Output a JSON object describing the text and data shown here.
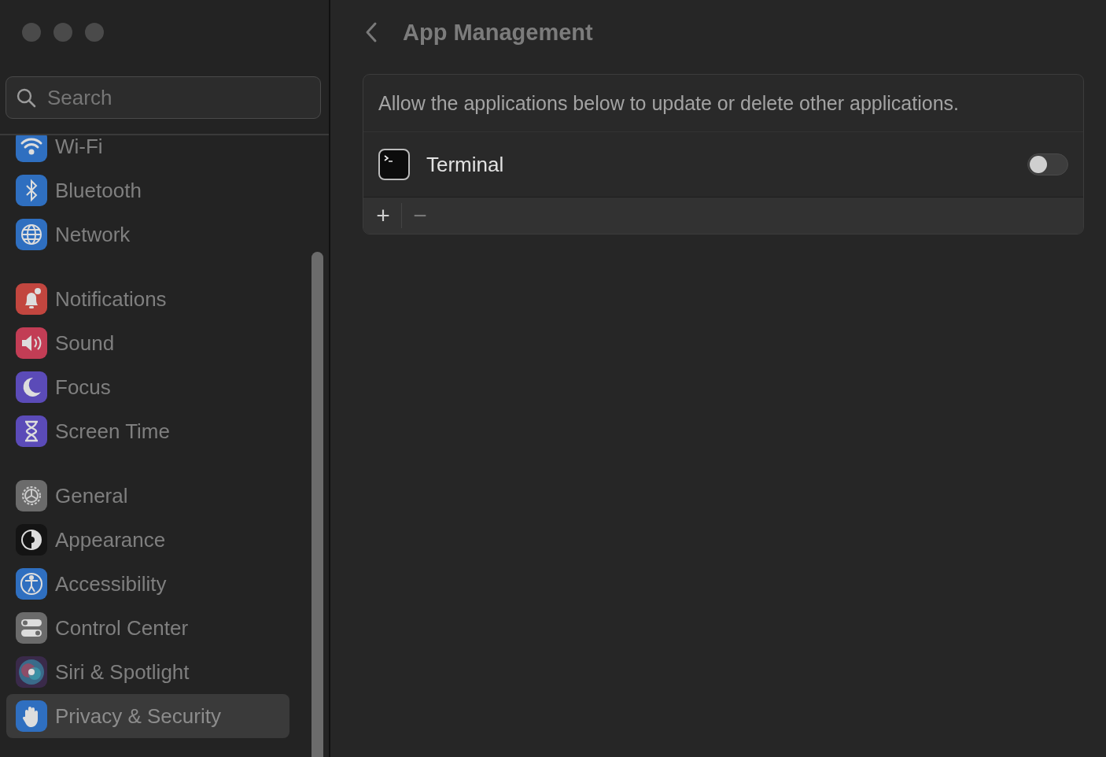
{
  "sidebar": {
    "search": {
      "placeholder": "Search"
    },
    "groups": [
      [
        {
          "label": "Wi-Fi",
          "kind": "wifi",
          "selected": false
        },
        {
          "label": "Bluetooth",
          "kind": "bluetooth",
          "selected": false
        },
        {
          "label": "Network",
          "kind": "network",
          "selected": false
        }
      ],
      [
        {
          "label": "Notifications",
          "kind": "notifications",
          "selected": false
        },
        {
          "label": "Sound",
          "kind": "sound",
          "selected": false
        },
        {
          "label": "Focus",
          "kind": "focus",
          "selected": false
        },
        {
          "label": "Screen Time",
          "kind": "screentime",
          "selected": false
        }
      ],
      [
        {
          "label": "General",
          "kind": "general",
          "selected": false
        },
        {
          "label": "Appearance",
          "kind": "appearance",
          "selected": false
        },
        {
          "label": "Accessibility",
          "kind": "accessibility",
          "selected": false
        },
        {
          "label": "Control Center",
          "kind": "controlcenter",
          "selected": false
        },
        {
          "label": "Siri & Spotlight",
          "kind": "siri",
          "selected": false
        },
        {
          "label": "Privacy & Security",
          "kind": "privacy",
          "selected": true
        }
      ]
    ]
  },
  "header": {
    "title": "App Management"
  },
  "panel": {
    "description": "Allow the applications below to update or delete other applications.",
    "apps": [
      {
        "name": "Terminal",
        "on": false
      }
    ],
    "buttons": [
      "+",
      "−"
    ]
  }
}
